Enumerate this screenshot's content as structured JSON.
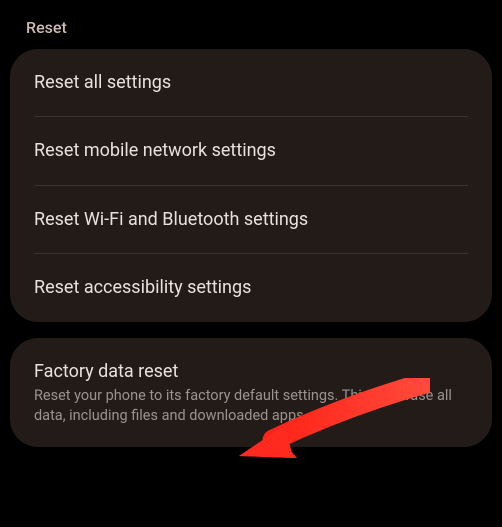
{
  "section": {
    "title": "Reset"
  },
  "reset_options": {
    "all_settings": "Reset all settings",
    "mobile_network": "Reset mobile network settings",
    "wifi_bluetooth": "Reset Wi-Fi and Bluetooth settings",
    "accessibility": "Reset accessibility settings"
  },
  "factory_reset": {
    "title": "Factory data reset",
    "description": "Reset your phone to its factory default settings. This will erase all data, including files and downloaded apps."
  },
  "annotation": {
    "arrow_color": "#ff3b30"
  }
}
